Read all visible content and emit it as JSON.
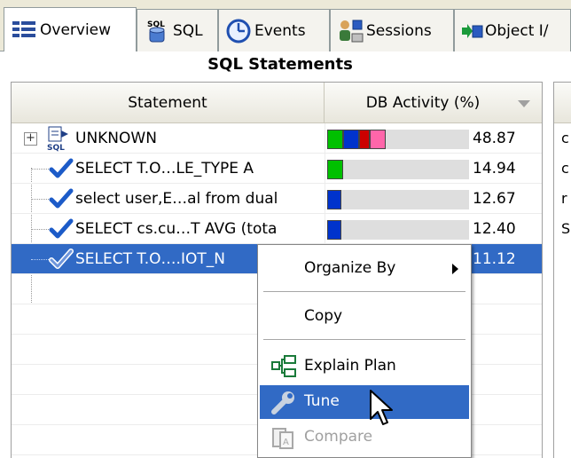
{
  "tabs": [
    {
      "label": "Overview",
      "icon": "overview-icon",
      "active": true
    },
    {
      "label": "SQL",
      "icon": "sql-icon",
      "active": false
    },
    {
      "label": "Events",
      "icon": "clock-icon",
      "active": false
    },
    {
      "label": "Sessions",
      "icon": "sessions-icon",
      "active": false
    },
    {
      "label": "Object I/",
      "icon": "object-io-icon",
      "active": false
    }
  ],
  "section": {
    "title": "SQL Statements"
  },
  "table": {
    "columns": {
      "statement": "Statement",
      "activity": "DB Activity (%)"
    },
    "rows": [
      {
        "statement": "UNKNOWN",
        "activity": "48.87",
        "segments": [
          "#00c000",
          "#0033cc",
          "#cc0000",
          "#ff66aa"
        ],
        "kind": "group"
      },
      {
        "statement": "SELECT T.O…LE_TYPE A",
        "activity": "14.94",
        "segments": [
          "#00c000"
        ],
        "kind": "check"
      },
      {
        "statement": "select user,E…al from dual",
        "activity": "12.67",
        "segments": [
          "#0033cc"
        ],
        "kind": "check"
      },
      {
        "statement": "SELECT cs.cu…T AVG (tota",
        "activity": "12.40",
        "segments": [
          "#0033cc"
        ],
        "kind": "check"
      },
      {
        "statement": "SELECT T.O….IOT_N",
        "activity": "11.12",
        "segments": [
          "#0033cc"
        ],
        "kind": "check-outline",
        "selected": true
      }
    ],
    "right_column_chars": [
      "c",
      "c",
      "r",
      "S"
    ]
  },
  "context_menu": {
    "organize_by": "Organize By",
    "copy": "Copy",
    "explain_plan": "Explain Plan",
    "tune": "Tune",
    "compare": "Compare"
  },
  "colors": {
    "selection": "#316ac5",
    "tab_bg": "#ece9d8"
  }
}
